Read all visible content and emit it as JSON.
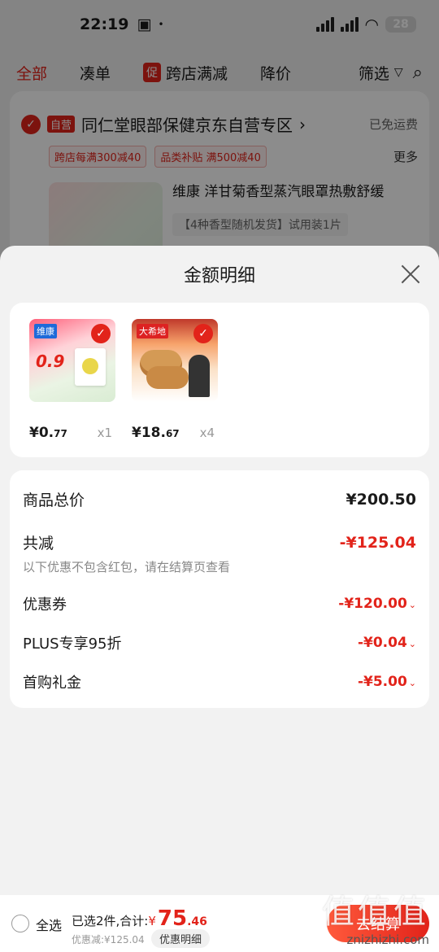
{
  "status_bar": {
    "time": "22:19",
    "battery": "28"
  },
  "top_tabs": {
    "all": "全部",
    "coudan": "凑单",
    "promo_badge": "促",
    "cross_store": "跨店满减",
    "price_drop": "降价",
    "filter": "筛选"
  },
  "store": {
    "self_badge": "自营",
    "name": "同仁堂眼部保健京东自营专区",
    "free_shipping": "已免运费",
    "promo1": "跨店每满300减40",
    "promo2": "品类补贴 满500减40",
    "more": "更多",
    "product_title": "维康 洋甘菊香型蒸汽眼罩热敷舒缓",
    "product_spec": "【4种香型随机发货】试用装1片"
  },
  "sheet": {
    "title": "金额明细",
    "items": [
      {
        "brand": "维康",
        "badge": "0.9",
        "price_int": "¥0.",
        "price_dec": "77",
        "qty": "x1"
      },
      {
        "brand": "大希地",
        "price_int": "¥18.",
        "price_dec": "67",
        "qty": "x4"
      }
    ],
    "total_label": "商品总价",
    "total_value": "¥200.50",
    "discount_label": "共减",
    "discount_value": "-¥125.04",
    "discount_note": "以下优惠不包含红包，请在结算页查看",
    "coupon_label": "优惠券",
    "coupon_value": "-¥120.00",
    "plus_label": "PLUS专享95折",
    "plus_value": "-¥0.04",
    "first_label": "首购礼金",
    "first_value": "-¥5.00"
  },
  "bottom": {
    "select_all": "全选",
    "selected_text": "已选2件,合计:",
    "currency": "¥",
    "total_int": "75",
    "total_dec": ".46",
    "saved": "优惠减:¥125.04",
    "detail_button": "优惠明细",
    "checkout": "去结算"
  },
  "watermark": {
    "line1": "值值值",
    "line2": "znizhizhi.com"
  },
  "colors": {
    "accent": "#e2231a"
  }
}
